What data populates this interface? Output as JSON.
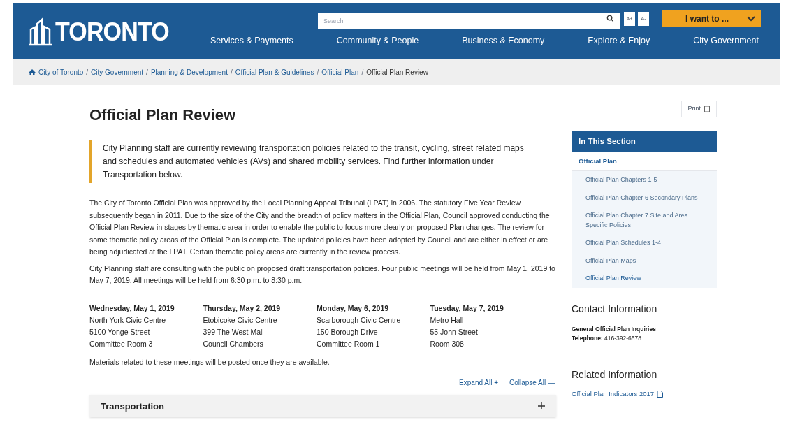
{
  "header": {
    "logo": "TORONTO",
    "search": {
      "placeholder": "Search"
    },
    "text_size_buttons": [
      "A+",
      "A-"
    ],
    "i_want_to": "I want to ...",
    "nav": [
      "Services & Payments",
      "Community & People",
      "Business & Economy",
      "Explore & Enjoy",
      "City Government"
    ]
  },
  "breadcrumb_separator": "/",
  "breadcrumb": [
    "City of Toronto",
    "City Government",
    "Planning & Development",
    "Official Plan & Guidelines",
    "Official Plan",
    "Official Plan Review"
  ],
  "title": "Official Plan Review",
  "print": "Print",
  "callout": "City Planning staff are currently reviewing transportation policies related to the transit, cycling, street related maps and schedules and automated vehicles (AVs) and shared mobility services. Find further information under Transportation below.",
  "paragraphs": [
    "The City of Toronto Official Plan was approved by the Local Planning Appeal Tribunal (LPAT) in 2006. The statutory Five Year Review subsequently began in 2011. Due to the size of the City and the breadth of policy matters in the Official Plan, Council approved conducting the Official Plan Review in stages by thematic area in order to enable the public to focus more clearly on proposed Plan changes. The review for some thematic policy areas of the Official Plan is complete. The updated policies have been adopted by Council and are either in effect or are being adjudicated at the LPAT. Certain thematic policy areas are currently in the review process.",
    "City Planning staff are consulting with the public on proposed draft transportation policies. Four public meetings will be held from May 1, 2019 to May 7, 2019. All meetings will be held from 6:30 p.m. to 8:30 p.m."
  ],
  "meetings": [
    {
      "date": "Wednesday, May 1, 2019",
      "lines": [
        "North York Civic Centre",
        "5100 Yonge Street",
        "Committee Room 3"
      ]
    },
    {
      "date": "Thursday, May 2, 2019",
      "lines": [
        "Etobicoke Civic Centre",
        "399 The West Mall",
        "Council Chambers"
      ]
    },
    {
      "date": "Monday, May 6, 2019",
      "lines": [
        "Scarborough Civic Centre",
        "150 Borough Drive",
        "Committee Room 1"
      ]
    },
    {
      "date": "Tuesday, May 7, 2019",
      "lines": [
        "Metro Hall",
        "55 John Street",
        "Room 308"
      ]
    }
  ],
  "materials_note": "Materials related to these meetings will be posted once they are available.",
  "expand_all": "Expand All +",
  "collapse_all": "Collapse All —",
  "accordion": [
    {
      "label": "Transportation",
      "expanded": false
    }
  ],
  "sidebar": {
    "heading": "In This Section",
    "parent": {
      "label": "Official Plan",
      "expanded": true,
      "children": [
        {
          "label": "Official Plan Chapters 1-5",
          "selected": false
        },
        {
          "label": "Official Plan Chapter 6 Secondary Plans",
          "selected": false
        },
        {
          "label": "Official Plan Chapter 7 Site and Area Specific Policies",
          "selected": false
        },
        {
          "label": "Official Plan Schedules 1-4",
          "selected": false
        },
        {
          "label": "Official Plan Maps",
          "selected": false
        },
        {
          "label": "Official Plan Review",
          "selected": true
        }
      ]
    }
  },
  "contact": {
    "heading": "Contact Information",
    "name": "General Official Plan Inquiries",
    "phone_label": "Telephone:",
    "phone": "416-392-6578"
  },
  "related": {
    "heading": "Related Information",
    "links": [
      "Official Plan Indicators 2017"
    ]
  }
}
